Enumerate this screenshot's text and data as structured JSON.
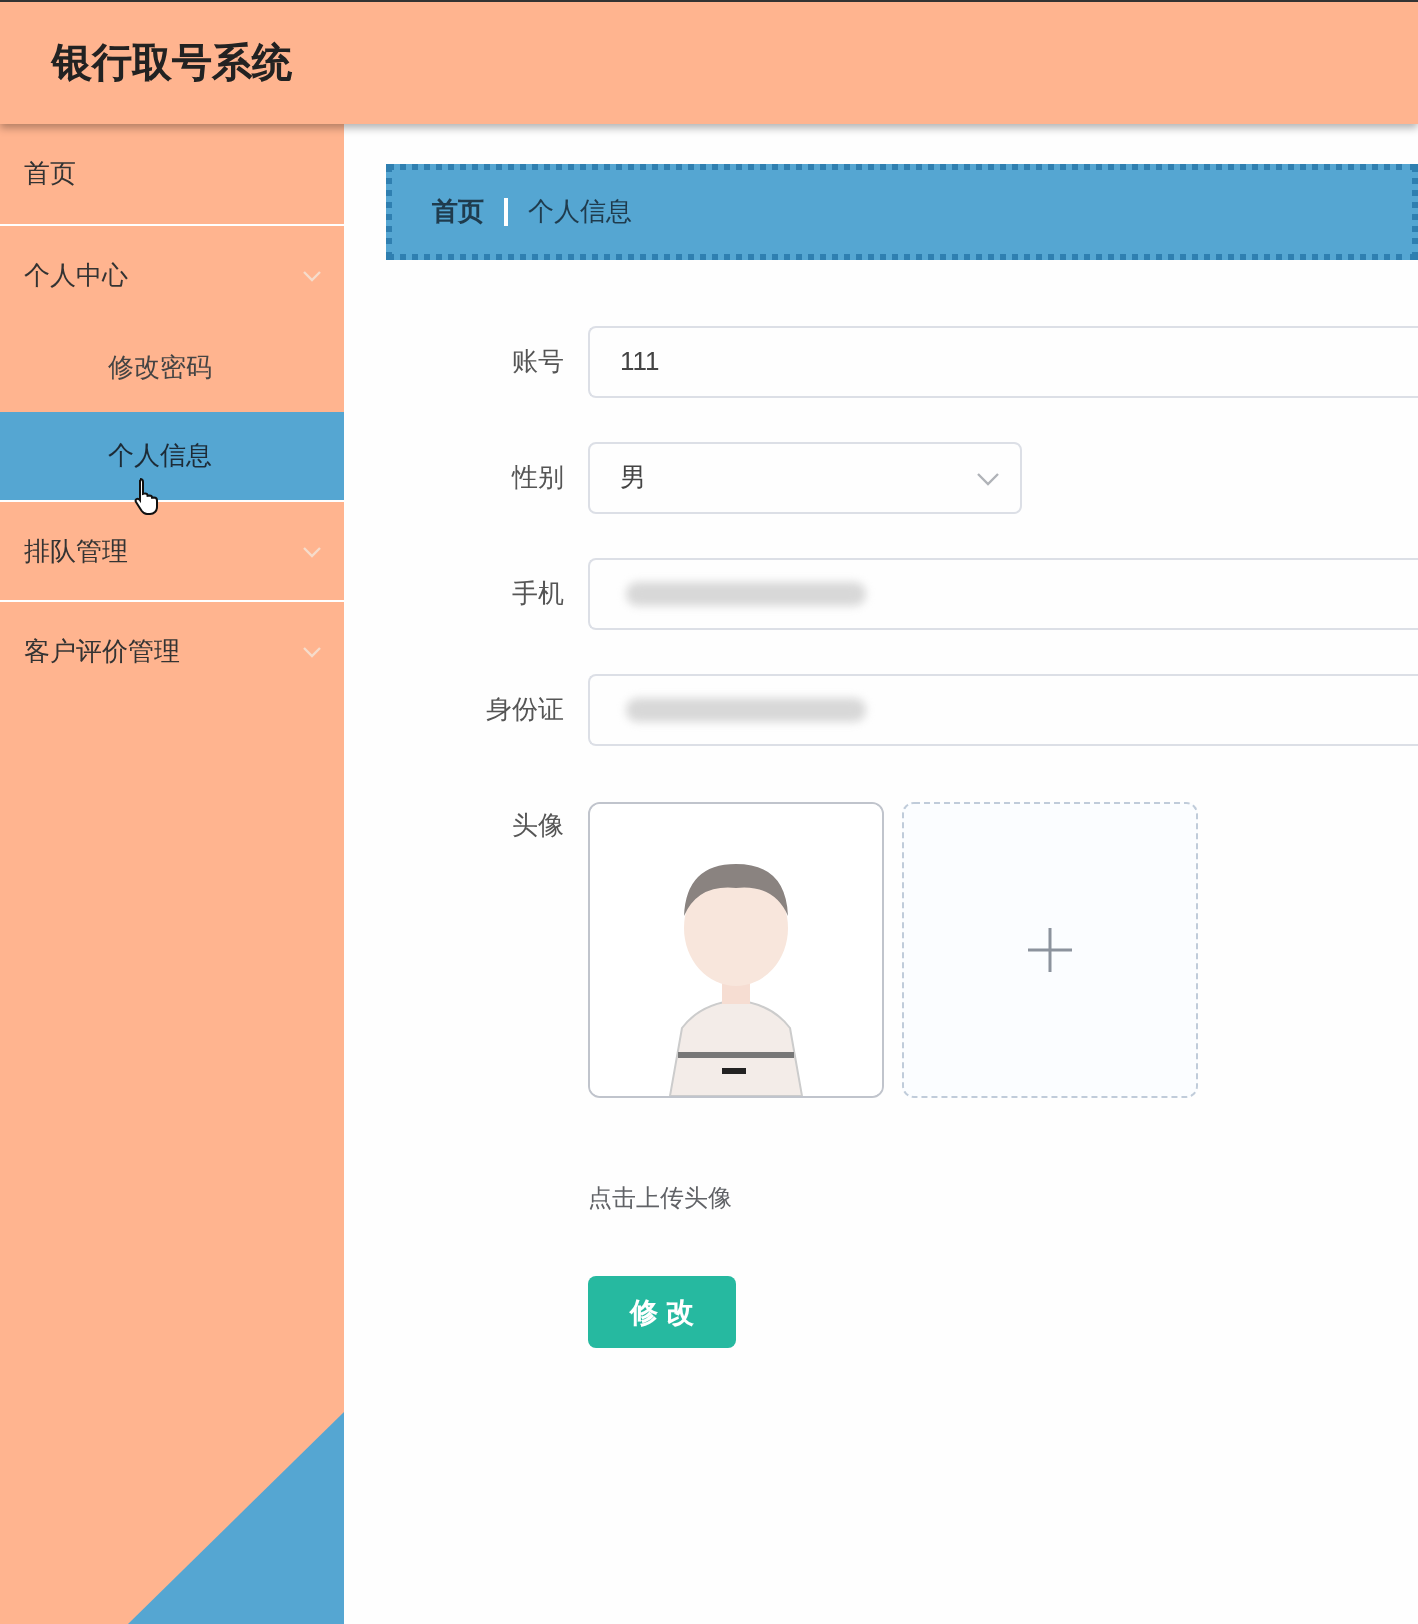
{
  "header": {
    "title": "银行取号系统"
  },
  "sidebar": {
    "items": [
      {
        "label": "首页",
        "kind": "link"
      },
      {
        "label": "个人中心",
        "kind": "submenu",
        "children": [
          {
            "label": "修改密码",
            "selected": false
          },
          {
            "label": "个人信息",
            "selected": true
          }
        ]
      },
      {
        "label": "排队管理",
        "kind": "submenu"
      },
      {
        "label": "客户评价管理",
        "kind": "submenu"
      }
    ]
  },
  "breadcrumb": [
    "首页",
    "个人信息"
  ],
  "form": {
    "fields": [
      {
        "label": "账号",
        "kind": "text",
        "value": "111"
      },
      {
        "label": "性别",
        "kind": "select",
        "value": "男"
      },
      {
        "label": "手机",
        "kind": "blurred"
      },
      {
        "label": "身份证",
        "kind": "blurred"
      },
      {
        "label": "头像",
        "kind": "avatar"
      }
    ],
    "hint": "点击上传头像",
    "submit": "修 改"
  }
}
